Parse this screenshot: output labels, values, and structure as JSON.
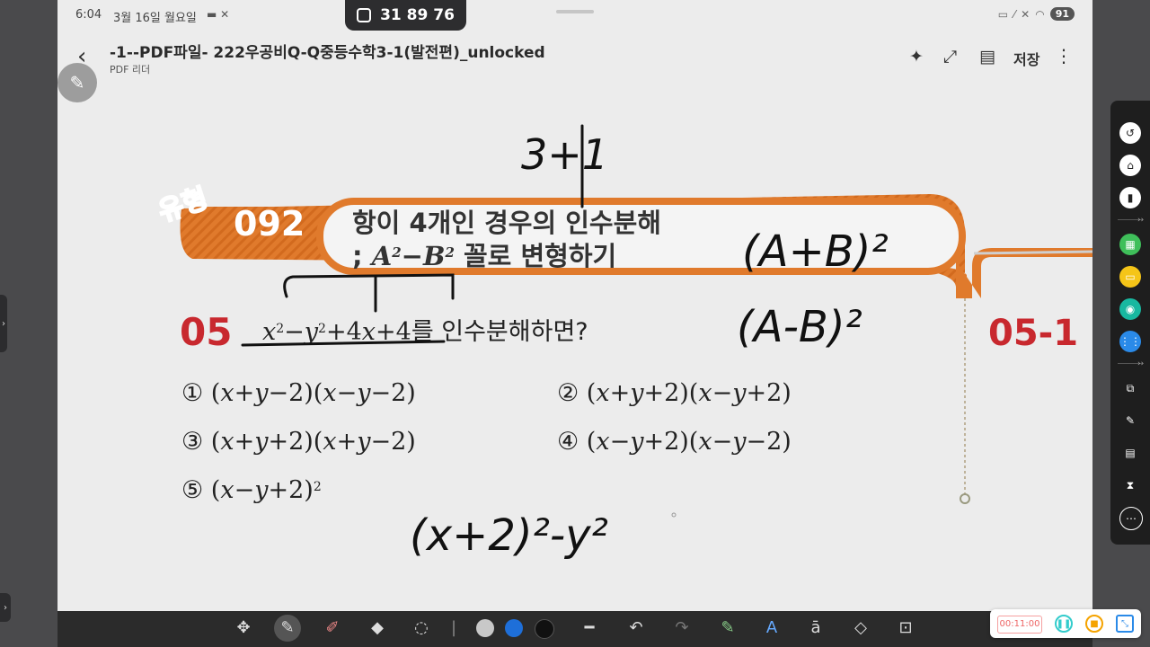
{
  "status": {
    "time": "6:04",
    "date": "3월 16일 월요일",
    "battery": "91"
  },
  "code_pill": {
    "code": "31 89 76"
  },
  "header": {
    "title": "-1--PDF파일- 222우공비Q-Q중등수학3-1(발전편)_unlocked",
    "subtitle": "PDF 리더",
    "save_label": "저장"
  },
  "page": {
    "badge": "유형",
    "type_number": "092",
    "heading_line1": "항이 4개인 경우의 인수분해",
    "heading_line2_prefix": "; ",
    "heading_line2_suffix": " 꼴로 변형하기",
    "problem_number": "05",
    "problem_suffix": "를 인수분해하면?",
    "next_problem_number": "05-1",
    "choices": [
      "①",
      "②",
      "③",
      "④",
      "⑤"
    ]
  },
  "handwriting": {
    "top": "3+1",
    "right1": "(A+B)²",
    "right2": "(A-B)²",
    "bottom": "(x+2)²-y²"
  },
  "recorder": {
    "elapsed": "00:11:00"
  },
  "colors": {
    "orange": "#e07a2c",
    "blue": "#1e6fd9",
    "red_number": "#c8282e"
  }
}
